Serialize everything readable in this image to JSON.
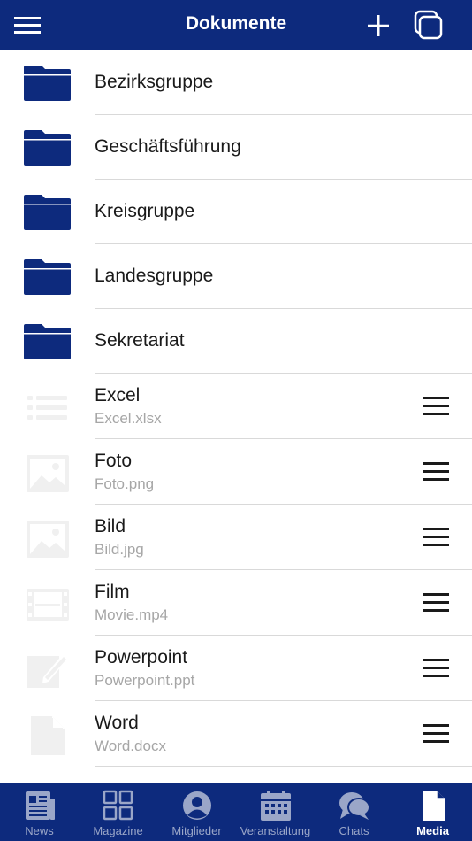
{
  "header": {
    "title": "Dokumente",
    "menu_icon": "hamburger-menu-icon",
    "add_icon": "plus-icon",
    "copy_icon": "copy-icon"
  },
  "folders": [
    {
      "label": "Bezirksgruppe",
      "icon": "folder-icon"
    },
    {
      "label": "Geschäftsführung",
      "icon": "folder-icon"
    },
    {
      "label": "Kreisgruppe",
      "icon": "folder-icon"
    },
    {
      "label": "Landesgruppe",
      "icon": "folder-icon"
    },
    {
      "label": "Sekretariat",
      "icon": "folder-icon"
    }
  ],
  "files": [
    {
      "name": "Excel",
      "filename": "Excel.xlsx",
      "icon": "list-icon"
    },
    {
      "name": "Foto",
      "filename": "Foto.png",
      "icon": "image-icon"
    },
    {
      "name": "Bild",
      "filename": "Bild.jpg",
      "icon": "image-icon"
    },
    {
      "name": "Film",
      "filename": "Movie.mp4",
      "icon": "film-icon"
    },
    {
      "name": "Powerpoint",
      "filename": "Powerpoint.ppt",
      "icon": "edit-icon"
    },
    {
      "name": "Word",
      "filename": "Word.docx",
      "icon": "document-icon"
    }
  ],
  "tabbar": {
    "items": [
      {
        "label": "News",
        "icon": "newspaper-icon",
        "active": false
      },
      {
        "label": "Magazine",
        "icon": "grid-icon",
        "active": false
      },
      {
        "label": "Mitglieder",
        "icon": "user-icon",
        "active": false
      },
      {
        "label": "Veranstaltung",
        "icon": "calendar-icon",
        "active": false
      },
      {
        "label": "Chats",
        "icon": "chat-bubbles-icon",
        "active": false
      },
      {
        "label": "Media",
        "icon": "document-icon",
        "active": true
      }
    ]
  },
  "colors": {
    "brand": "#0d2a7d",
    "inactive_tab": "#9aa6c8",
    "secondary_text": "#a6a6a6",
    "file_icon": "#f0f0f0"
  }
}
